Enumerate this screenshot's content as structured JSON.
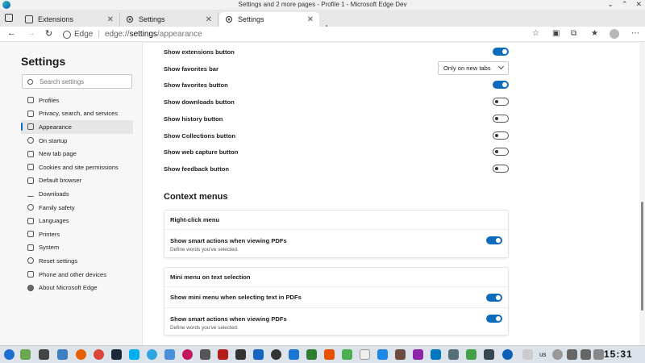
{
  "window": {
    "title": "Settings and 2 more pages - Profile 1 - Microsoft  Edge Dev",
    "controls": [
      "minimize",
      "maximize",
      "close"
    ]
  },
  "tabs": [
    {
      "label": "Extensions",
      "icon": "extensions-icon",
      "active": false
    },
    {
      "label": "Settings",
      "icon": "gear-icon",
      "active": false
    },
    {
      "label": "Settings",
      "icon": "gear-icon",
      "active": true
    }
  ],
  "address": {
    "brand": "Edge",
    "host": "edge://",
    "bold": "settings",
    "path": "/appearance"
  },
  "sidebar": {
    "title": "Settings",
    "search_placeholder": "Search settings",
    "items": [
      {
        "label": "Profiles",
        "icon": "profile-icon"
      },
      {
        "label": "Privacy, search, and services",
        "icon": "lock-icon"
      },
      {
        "label": "Appearance",
        "icon": "appearance-icon",
        "active": true
      },
      {
        "label": "On startup",
        "icon": "power-icon"
      },
      {
        "label": "New tab page",
        "icon": "newtab-icon"
      },
      {
        "label": "Cookies and site permissions",
        "icon": "cookie-icon"
      },
      {
        "label": "Default browser",
        "icon": "browser-icon"
      },
      {
        "label": "Downloads",
        "icon": "download-icon"
      },
      {
        "label": "Family safety",
        "icon": "family-icon"
      },
      {
        "label": "Languages",
        "icon": "languages-icon"
      },
      {
        "label": "Printers",
        "icon": "printer-icon"
      },
      {
        "label": "System",
        "icon": "system-icon"
      },
      {
        "label": "Reset settings",
        "icon": "reset-icon"
      },
      {
        "label": "Phone and other devices",
        "icon": "phone-icon"
      },
      {
        "label": "About Microsoft Edge",
        "icon": "edge-icon"
      }
    ]
  },
  "toolbar_settings": [
    {
      "label": "Show extensions button",
      "type": "toggle",
      "on": true
    },
    {
      "label": "Show favorites bar",
      "type": "dropdown",
      "value": "Only on new tabs"
    },
    {
      "label": "Show favorites button",
      "type": "toggle",
      "on": true
    },
    {
      "label": "Show downloads button",
      "type": "toggle",
      "on": false
    },
    {
      "label": "Show history button",
      "type": "toggle",
      "on": false
    },
    {
      "label": "Show Collections button",
      "type": "toggle",
      "on": false
    },
    {
      "label": "Show web capture button",
      "type": "toggle",
      "on": false
    },
    {
      "label": "Show feedback button",
      "type": "toggle",
      "on": false
    }
  ],
  "context_menus": {
    "title": "Context menus",
    "right_click": {
      "header": "Right-click menu",
      "rows": [
        {
          "label": "Show smart actions when viewing PDFs",
          "sub": "Define words you've selected.",
          "on": true
        }
      ]
    },
    "mini_menu": {
      "header": "Mini menu on text selection",
      "rows": [
        {
          "label": "Show mini menu when selecting text in PDFs",
          "sub": "",
          "on": true
        },
        {
          "label": "Show smart actions when viewing PDFs",
          "sub": "Define words you've selected.",
          "on": true
        }
      ]
    }
  },
  "taskbar": {
    "tray_lang": "us",
    "clock": "15:31"
  },
  "colors": {
    "accent": "#0f6cbd",
    "sidebar_bg": "#f7f7f7",
    "taskbar_bg": "#dce3ea"
  }
}
